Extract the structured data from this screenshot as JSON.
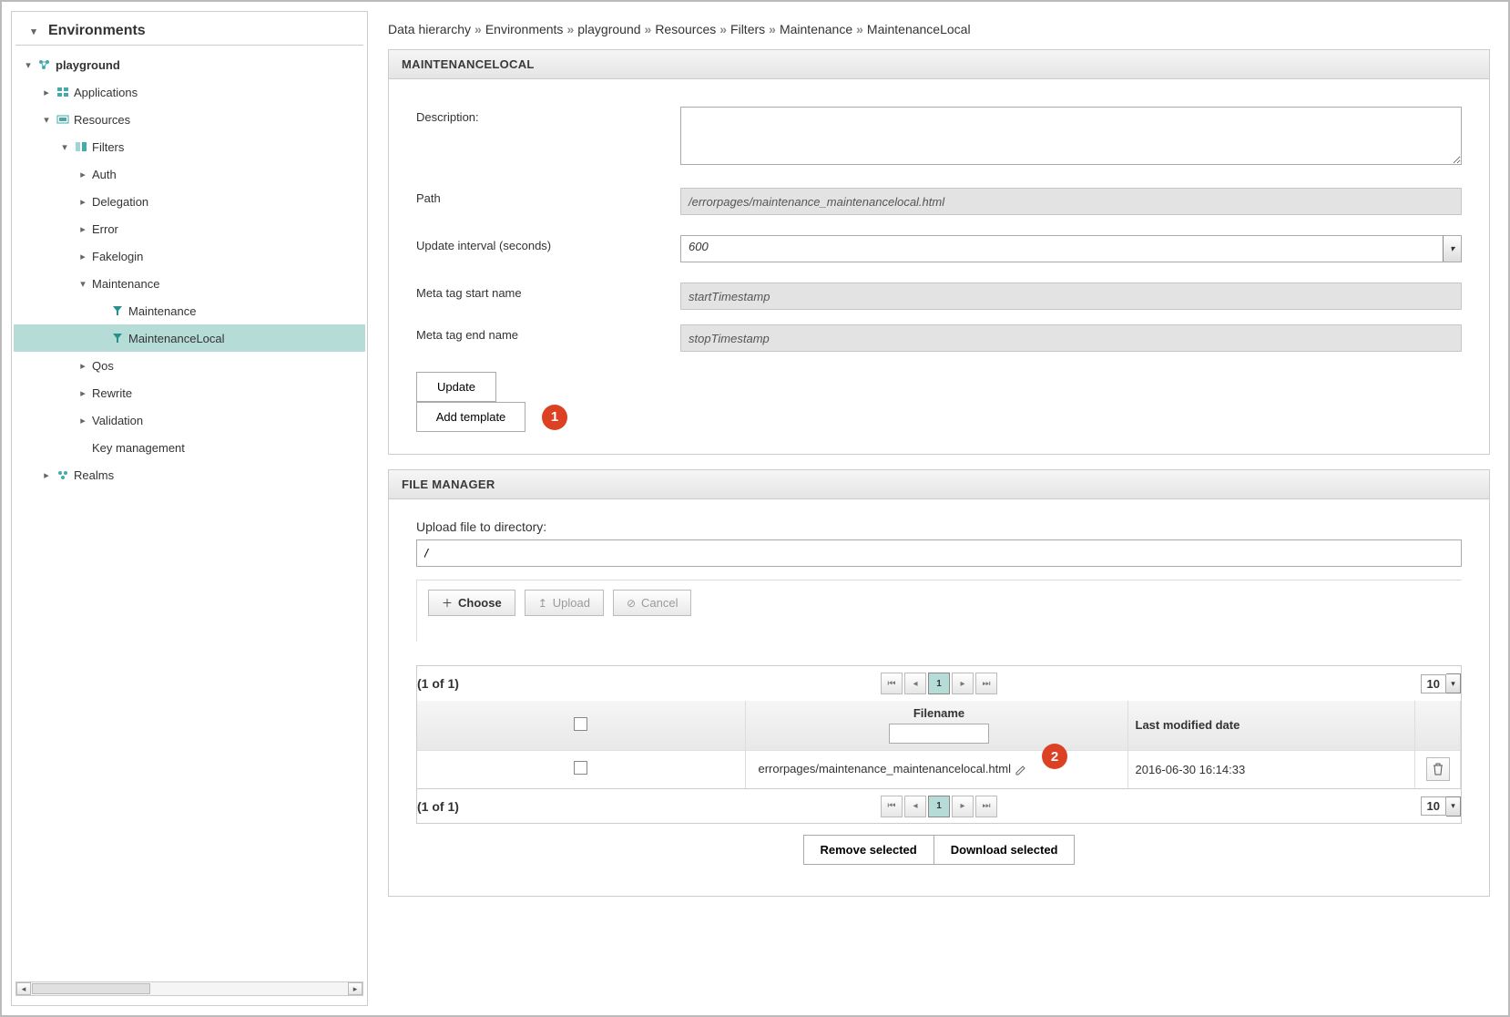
{
  "sidebar": {
    "title": "Environments",
    "tree": [
      {
        "indent": 0,
        "caret": "down",
        "icon": "env",
        "bold": true,
        "label": "playground"
      },
      {
        "indent": 1,
        "caret": "right",
        "icon": "app",
        "bold": false,
        "label": "Applications"
      },
      {
        "indent": 1,
        "caret": "down",
        "icon": "res",
        "bold": false,
        "label": "Resources"
      },
      {
        "indent": 2,
        "caret": "down",
        "icon": "filter",
        "bold": false,
        "label": "Filters"
      },
      {
        "indent": 3,
        "caret": "right",
        "icon": "",
        "bold": false,
        "label": "Auth"
      },
      {
        "indent": 3,
        "caret": "right",
        "icon": "",
        "bold": false,
        "label": "Delegation"
      },
      {
        "indent": 3,
        "caret": "right",
        "icon": "",
        "bold": false,
        "label": "Error"
      },
      {
        "indent": 3,
        "caret": "right",
        "icon": "",
        "bold": false,
        "label": "Fakelogin"
      },
      {
        "indent": 3,
        "caret": "down",
        "icon": "",
        "bold": false,
        "label": "Maintenance"
      },
      {
        "indent": 4,
        "caret": "",
        "icon": "funnel",
        "bold": false,
        "label": "Maintenance"
      },
      {
        "indent": 4,
        "caret": "",
        "icon": "funnel",
        "bold": false,
        "label": "MaintenanceLocal",
        "selected": true
      },
      {
        "indent": 3,
        "caret": "right",
        "icon": "",
        "bold": false,
        "label": "Qos"
      },
      {
        "indent": 3,
        "caret": "right",
        "icon": "",
        "bold": false,
        "label": "Rewrite"
      },
      {
        "indent": 3,
        "caret": "right",
        "icon": "",
        "bold": false,
        "label": "Validation"
      },
      {
        "indent": 3,
        "caret": "",
        "icon": "",
        "bold": false,
        "label": "Key management"
      },
      {
        "indent": 1,
        "caret": "right",
        "icon": "realm",
        "bold": false,
        "label": "Realms"
      }
    ]
  },
  "breadcrumb": [
    "Data hierarchy",
    "Environments",
    "playground",
    "Resources",
    "Filters",
    "Maintenance",
    "MaintenanceLocal"
  ],
  "panel1": {
    "title": "MAINTENANCELOCAL",
    "labels": {
      "description": "Description:",
      "path": "Path",
      "update_interval": "Update interval (seconds)",
      "meta_start": "Meta tag start name",
      "meta_end": "Meta tag end name"
    },
    "values": {
      "description": "",
      "path": "/errorpages/maintenance_maintenancelocal.html",
      "update_interval": "600",
      "meta_start": "startTimestamp",
      "meta_end": "stopTimestamp"
    },
    "buttons": {
      "update": "Update",
      "add_template": "Add template"
    },
    "badge1": "1"
  },
  "panel2": {
    "title": "FILE MANAGER",
    "upload_label": "Upload file to directory:",
    "upload_path": "/",
    "buttons": {
      "choose": "Choose",
      "upload": "Upload",
      "cancel": "Cancel",
      "remove": "Remove selected",
      "download": "Download selected"
    },
    "pager": {
      "info": "(1 of 1)",
      "current_page": "1",
      "rows": "10"
    },
    "table": {
      "headers": {
        "filename": "Filename",
        "modified": "Last modified date"
      },
      "rows": [
        {
          "filename": "errorpages/maintenance_maintenancelocal.html",
          "modified": "2016-06-30 16:14:33"
        }
      ]
    },
    "badge2": "2"
  }
}
